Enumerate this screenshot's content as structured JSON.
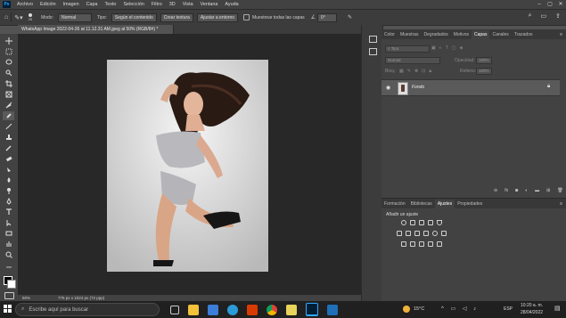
{
  "menubar": {
    "app_logo": "Ps",
    "items": [
      "Archivo",
      "Edición",
      "Imagen",
      "Capa",
      "Texto",
      "Selección",
      "Filtro",
      "3D",
      "Vista",
      "Ventana",
      "Ayuda"
    ]
  },
  "options_bar": {
    "brush_size": "25",
    "mode_label": "Modo:",
    "mode_value": "Normal",
    "type_label": "Tipo:",
    "type_opt1": "Según el contenido",
    "type_opt2": "Crear textura",
    "type_opt3": "Ajustar a entorno",
    "sample_all_label": "Muestrear todas las capas",
    "angle_value": "0°"
  },
  "document": {
    "tab_title": "WhatsApp Image 2022-04-26 at 11.12.31 AM.jpeg al 50% (RGB/8#) *"
  },
  "status_bar": {
    "zoom": "50%",
    "doc_size": "775 px x 1024 px (72 ppp)"
  },
  "layers_panel": {
    "tabs": [
      "Color",
      "Muestras",
      "Degradados",
      "Motivos",
      "Capas",
      "Canales",
      "Trazados"
    ],
    "active_tab": "Capas",
    "search_placeholder": "Tipo",
    "blend_mode": "Normal",
    "opacity_label": "Opacidad:",
    "opacity_value": "100%",
    "lock_label": "Bloq.:",
    "fill_label": "Relleno:",
    "fill_value": "100%",
    "layer_name": "Fondo"
  },
  "adjustments_panel": {
    "tabs": [
      "Formación",
      "Bibliotecas",
      "Ajustes",
      "Propiedades"
    ],
    "active_tab": "Ajustes",
    "heading": "Añadir un ajuste"
  },
  "taskbar": {
    "search_placeholder": "Escribe aquí para buscar",
    "weather": "15°C",
    "language": "ESP",
    "time": "10:20 a. m.",
    "date": "28/04/2022"
  },
  "colors": {
    "ps_dark": "#424242",
    "canvas_bg": "#282828",
    "accent_blue": "#31a8ff"
  }
}
